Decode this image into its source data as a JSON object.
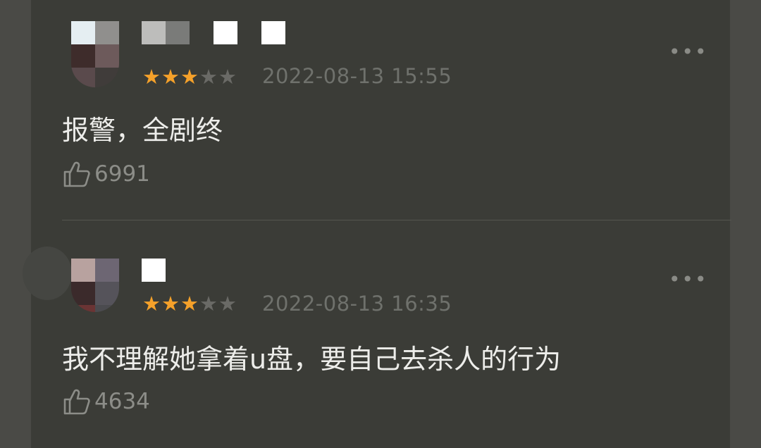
{
  "comments": [
    {
      "rating": 3,
      "max_rating": 5,
      "date": "2022-08-13 15:55",
      "text": "报警，全剧终",
      "likes": "6991",
      "more_label": "•••",
      "avatar_colors": [
        "#e5eef2",
        "#908f8d",
        "#3e2c2b",
        "#6d5a5b",
        "#5a4a4c",
        "#403c3a"
      ],
      "name_colors": [
        "#bdbdbb",
        "#7a7b79",
        "#ffffff",
        "#ffffff"
      ]
    },
    {
      "rating": 3,
      "max_rating": 5,
      "date": "2022-08-13 16:35",
      "text": "我不理解她拿着u盘，要自己去杀人的行为",
      "likes": "4634",
      "more_label": "•••",
      "avatar_colors": [
        "#b8a29f",
        "#6d6673",
        "#3b2a2b",
        "#55535a",
        "#6b3434",
        "#4b4b4f"
      ],
      "name_colors": [
        "#ffffff"
      ]
    }
  ],
  "icons": {
    "like": "thumbs-up-icon",
    "more": "more-dots-icon",
    "star": "star-icon"
  }
}
